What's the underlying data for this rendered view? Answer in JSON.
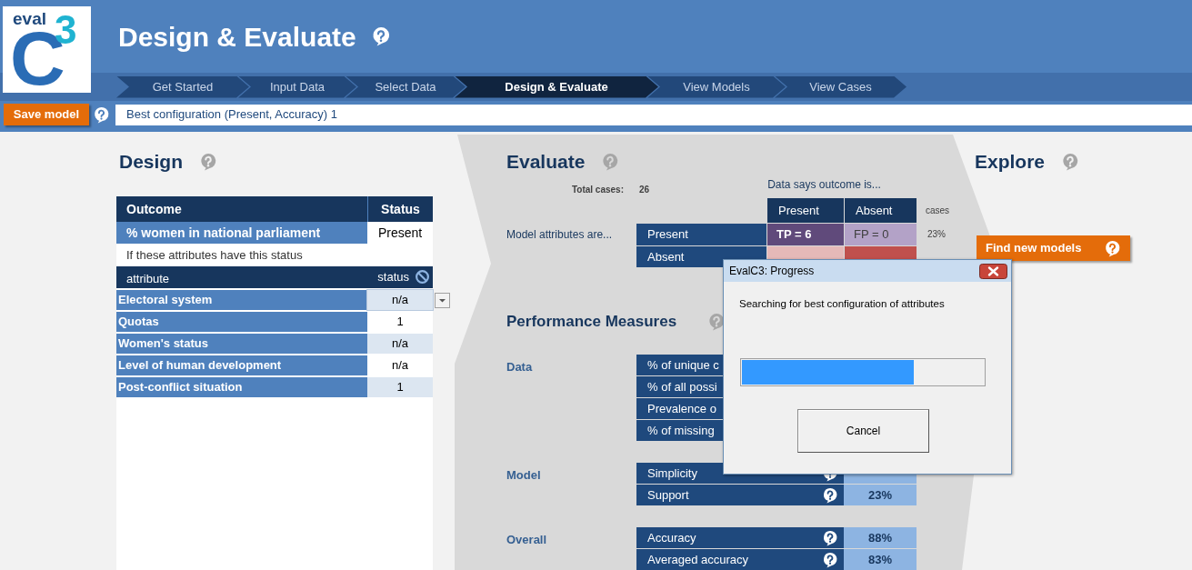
{
  "logo": {
    "word": "eval",
    "letter": "C",
    "superscript": "3"
  },
  "header": {
    "title": "Design & Evaluate"
  },
  "steps": [
    {
      "label": "Get Started",
      "selected": false
    },
    {
      "label": "Input Data",
      "selected": false
    },
    {
      "label": "Select Data",
      "selected": false
    },
    {
      "label": "Design & Evaluate",
      "selected": true
    },
    {
      "label": "View Models",
      "selected": false
    },
    {
      "label": "View Cases",
      "selected": false
    }
  ],
  "toolbar": {
    "save_button": "Save model",
    "model_name": "Best configuration (Present, Accuracy) 1"
  },
  "design": {
    "title": "Design",
    "outcome_header": "Outcome",
    "status_header": "Status",
    "outcome": "% women in national parliament",
    "outcome_status": "Present",
    "hint": "If these attributes have this status",
    "attribute_header": "attribute",
    "attribute_status_header": "status",
    "attributes": [
      {
        "name": "Electoral system",
        "status": "n/a",
        "selected": true
      },
      {
        "name": "Quotas",
        "status": "1",
        "selected": false
      },
      {
        "name": "Women's status",
        "status": "n/a",
        "selected": false
      },
      {
        "name": "Level of human development",
        "status": "n/a",
        "selected": false
      },
      {
        "name": "Post-conflict situation",
        "status": "1",
        "selected": false
      }
    ]
  },
  "evaluate": {
    "title": "Evaluate",
    "total_label": "Total cases:",
    "total": "26",
    "matrix_caption": "Data says outcome is...",
    "row_caption": "Model attributes are...",
    "columns": [
      "Present",
      "Absent"
    ],
    "cases_header": "cases",
    "rows": [
      {
        "label": "Present",
        "cells": [
          {
            "text": "TP = 6",
            "color": "#604a7b"
          },
          {
            "text": "FP = 0",
            "color": "#b3a2c7"
          }
        ],
        "share": "23%"
      },
      {
        "label": "Absent",
        "cells": [
          {
            "color": "#e6b9b8"
          },
          {
            "color": "#c0504d"
          }
        ]
      }
    ]
  },
  "performance": {
    "title": "Performance Measures",
    "groups": [
      {
        "label": "Data",
        "rows": [
          {
            "label": "% of unique c"
          },
          {
            "label": "% of all possi"
          },
          {
            "label": "Prevalence o"
          },
          {
            "label": "% of missing"
          }
        ]
      },
      {
        "label": "Model",
        "rows": [
          {
            "label": "Simplicity",
            "help": true
          },
          {
            "label": "Support",
            "value": "23%",
            "help": true
          }
        ]
      },
      {
        "label": "Overall",
        "rows": [
          {
            "label": "Accuracy",
            "value": "88%",
            "help": true
          },
          {
            "label": "Averaged accuracy",
            "value": "83%",
            "help": true
          }
        ]
      }
    ]
  },
  "explore": {
    "title": "Explore",
    "button": "Find new models"
  },
  "dialog": {
    "title": "EvalC3: Progress",
    "message": "Searching for best configuration of attributes",
    "progress": {
      "level": 0.71
    },
    "button": "Cancel"
  }
}
